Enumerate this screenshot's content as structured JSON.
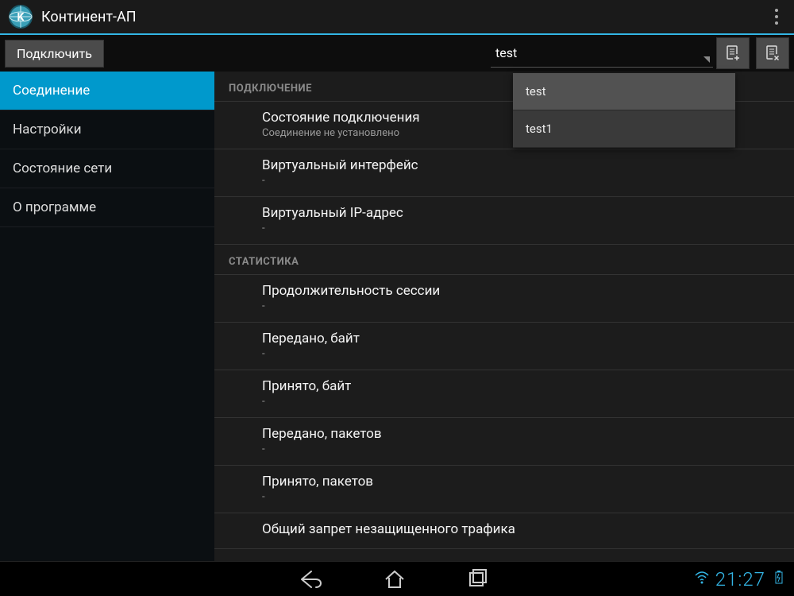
{
  "app": {
    "title": "Континент-АП"
  },
  "action": {
    "connect_label": "Подключить",
    "profile_value": "test"
  },
  "dropdown": {
    "items": [
      "test",
      "test1"
    ],
    "active_index": 0
  },
  "sidebar": {
    "items": [
      "Соединение",
      "Настройки",
      "Состояние сети",
      "О программе"
    ],
    "active_index": 0
  },
  "sections": [
    {
      "header": "ПОДКЛЮЧЕНИЕ",
      "rows": [
        {
          "label": "Состояние подключения",
          "value": "Соединение не установлено"
        },
        {
          "label": "Виртуальный интерфейс",
          "value": "-"
        },
        {
          "label": "Виртуальный IP-адрес",
          "value": "-"
        }
      ]
    },
    {
      "header": "СТАТИСТИКА",
      "rows": [
        {
          "label": "Продолжительность сессии",
          "value": "-"
        },
        {
          "label": "Передано, байт",
          "value": "-"
        },
        {
          "label": "Принято, байт",
          "value": "-"
        },
        {
          "label": "Передано, пакетов",
          "value": "-"
        },
        {
          "label": "Принято, пакетов",
          "value": "-"
        },
        {
          "label": "Общий запрет незащищенного трафика",
          "value": ""
        }
      ]
    }
  ],
  "status": {
    "time": "21:27"
  }
}
